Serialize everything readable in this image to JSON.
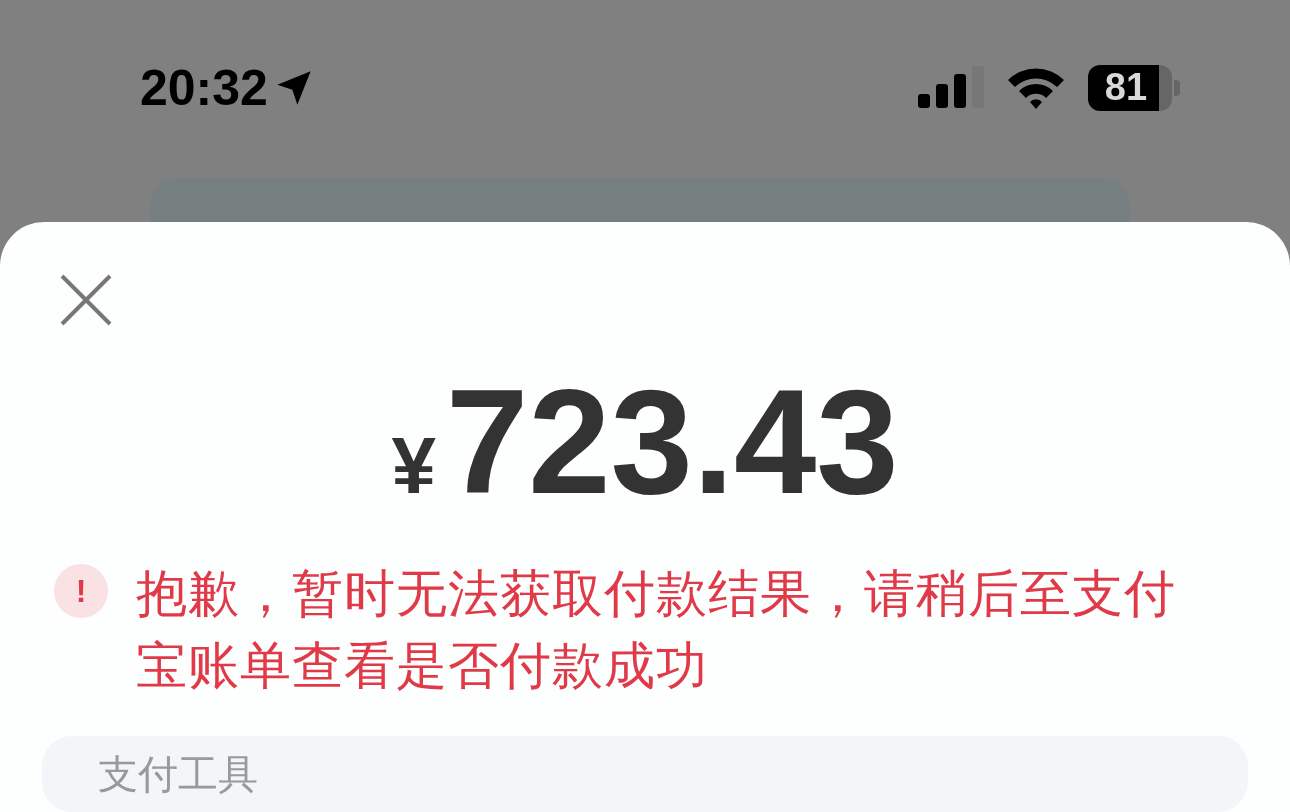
{
  "status_bar": {
    "time": "20:32",
    "battery": "81"
  },
  "sheet": {
    "amount_currency": "¥",
    "amount": "723.43",
    "error_message": "抱歉，暂时无法获取付款结果，请稍后至支付宝账单查看是否付款成功",
    "error_icon": "!",
    "card_label": "支付工具"
  }
}
